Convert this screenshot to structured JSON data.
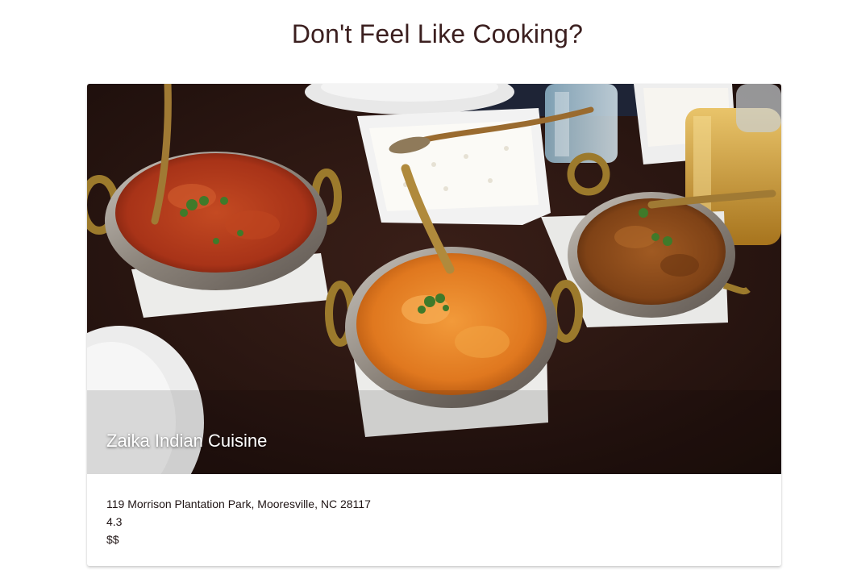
{
  "page": {
    "title": "Don't Feel Like Cooking?"
  },
  "restaurant": {
    "name": "Zaika Indian Cuisine",
    "address": "119 Morrison Plantation Park, Mooresville, NC 28117",
    "rating": "4.3",
    "price": "$$",
    "image_icon": "food-photo-curry-dishes"
  },
  "colors": {
    "title": "#3b1f1f",
    "table": "#2a1612",
    "curry_red": "#b43a1c",
    "curry_orange": "#e07a22",
    "curry_brown": "#8a4a1c"
  }
}
